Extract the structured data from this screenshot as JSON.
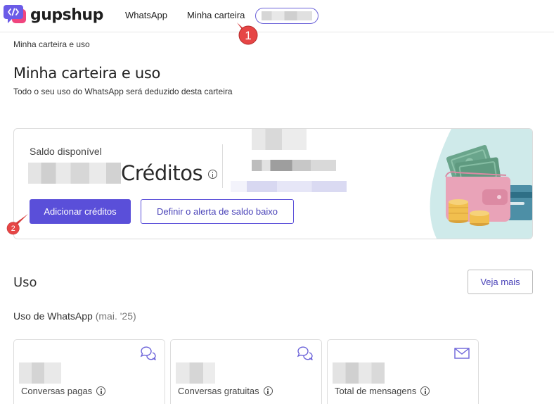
{
  "brand": {
    "name": "gupshup",
    "accent": "#5a4fd9"
  },
  "nav": {
    "whatsapp": "WhatsApp",
    "wallet": "Minha carteira"
  },
  "markers": {
    "one": "1",
    "two": "2"
  },
  "breadcrumb": "Minha carteira e uso",
  "page": {
    "title": "Minha carteira e uso",
    "subtitle": "Todo o seu uso do WhatsApp será deduzido desta carteira"
  },
  "balance": {
    "label": "Saldo disponível",
    "unit": "Créditos",
    "add_button": "Adicionar créditos",
    "alert_button": "Definir o alerta de saldo baixo"
  },
  "usage": {
    "title": "Uso",
    "more_button": "Veja mais",
    "whatsapp_title": "Uso de WhatsApp",
    "period": "(mai. '25)",
    "cards": [
      {
        "label": "Conversas pagas",
        "icon": "chat-bubbles-icon"
      },
      {
        "label": "Conversas gratuitas",
        "icon": "chat-bubbles-icon"
      },
      {
        "label": "Total de mensagens",
        "icon": "envelope-icon"
      }
    ]
  }
}
